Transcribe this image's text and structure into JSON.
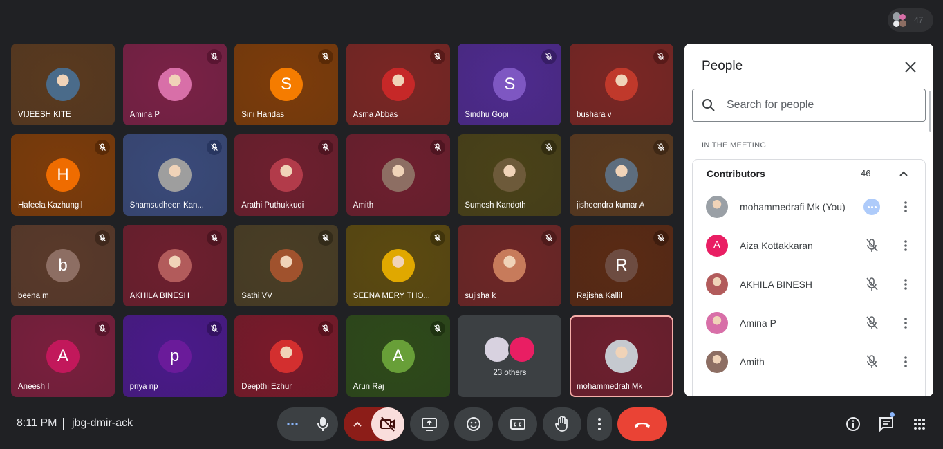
{
  "participant_count": "47",
  "tiles": [
    {
      "name": "VIJEESH KITE",
      "bg": "#5a3a1f",
      "avatar": {
        "kind": "photo",
        "color": "#4a6b8a"
      },
      "muted": false,
      "mute_bg": ""
    },
    {
      "name": "Amina P",
      "bg": "#7a2146",
      "avatar": {
        "kind": "photo",
        "color": "#d86fa8"
      },
      "muted": true,
      "mute_bg": "#5a1532"
    },
    {
      "name": "Sini Haridas",
      "bg": "#7d3c0a",
      "avatar": {
        "kind": "letter",
        "letter": "S",
        "color": "#f57c00"
      },
      "muted": true,
      "mute_bg": "#5a2a06"
    },
    {
      "name": "Asma Abbas",
      "bg": "#7a2624",
      "avatar": {
        "kind": "photo",
        "color": "#c62828"
      },
      "muted": true,
      "mute_bg": "#581a19"
    },
    {
      "name": "Sindhu Gopi",
      "bg": "#4e2a8e",
      "avatar": {
        "kind": "letter",
        "letter": "S",
        "color": "#7e57c2"
      },
      "muted": true,
      "mute_bg": "#371d66"
    },
    {
      "name": "bushara v",
      "bg": "#7a2624",
      "avatar": {
        "kind": "photo",
        "color": "#c0392b"
      },
      "muted": true,
      "mute_bg": "#581a19"
    },
    {
      "name": "Hafeela Kazhungil",
      "bg": "#7d3c0a",
      "avatar": {
        "kind": "letter",
        "letter": "H",
        "color": "#ef6c00"
      },
      "muted": true,
      "mute_bg": "#5a2a06"
    },
    {
      "name": "Shamsudheen Kan...",
      "bg": "#3a4a7a",
      "avatar": {
        "kind": "photo",
        "color": "#9e9e9e"
      },
      "muted": true,
      "mute_bg": "#283660"
    },
    {
      "name": "Arathi Puthukkudi",
      "bg": "#6e1f2e",
      "avatar": {
        "kind": "photo",
        "color": "#b23b4a"
      },
      "muted": true,
      "mute_bg": "#4f1521"
    },
    {
      "name": "Amith",
      "bg": "#6e1f2e",
      "avatar": {
        "kind": "photo",
        "color": "#8d6e63"
      },
      "muted": true,
      "mute_bg": "#4f1521"
    },
    {
      "name": "Sumesh Kandoth",
      "bg": "#4a4218",
      "avatar": {
        "kind": "photo",
        "color": "#6d5a3a"
      },
      "muted": true,
      "mute_bg": "#332d10"
    },
    {
      "name": "jisheendra kumar A",
      "bg": "#5a3a1f",
      "avatar": {
        "kind": "photo",
        "color": "#5d6d7e"
      },
      "muted": true,
      "mute_bg": "#3f2815"
    },
    {
      "name": "beena m",
      "bg": "#5a3a2a",
      "avatar": {
        "kind": "letter",
        "letter": "b",
        "color": "#8d6e63"
      },
      "muted": true,
      "mute_bg": "#3f281c"
    },
    {
      "name": "AKHILA BINESH",
      "bg": "#6e1f2e",
      "avatar": {
        "kind": "photo",
        "color": "#b25b5b"
      },
      "muted": true,
      "mute_bg": "#4f1521"
    },
    {
      "name": "Sathi VV",
      "bg": "#4a3e25",
      "avatar": {
        "kind": "photo",
        "color": "#a0522d"
      },
      "muted": true,
      "mute_bg": "#332b19"
    },
    {
      "name": "SEENA MERY THO...",
      "bg": "#5c4a10",
      "avatar": {
        "kind": "photo",
        "color": "#e0a800"
      },
      "muted": true,
      "mute_bg": "#40340b"
    },
    {
      "name": "sujisha k",
      "bg": "#6e2626",
      "avatar": {
        "kind": "photo",
        "color": "#c77b5b"
      },
      "muted": true,
      "mute_bg": "#4f1b1b"
    },
    {
      "name": "Rajisha Kallil",
      "bg": "#5a2a14",
      "avatar": {
        "kind": "letter",
        "letter": "R",
        "color": "#6d4c41"
      },
      "muted": true,
      "mute_bg": "#3f1d0e"
    },
    {
      "name": "Aneesh I",
      "bg": "#7a1f3d",
      "avatar": {
        "kind": "letter",
        "letter": "A",
        "color": "#c2185b"
      },
      "muted": true,
      "mute_bg": "#59162c"
    },
    {
      "name": "priya np",
      "bg": "#4a1a8a",
      "avatar": {
        "kind": "letter",
        "letter": "p",
        "color": "#6a1b9a"
      },
      "muted": true,
      "mute_bg": "#341262"
    },
    {
      "name": "Deepthi Ezhur",
      "bg": "#7a1a2a",
      "avatar": {
        "kind": "photo",
        "color": "#d32f2f"
      },
      "muted": true,
      "mute_bg": "#59121e"
    },
    {
      "name": "Arun Raj",
      "bg": "#2e4a1a",
      "avatar": {
        "kind": "letter",
        "letter": "A",
        "color": "#689f38"
      },
      "muted": true,
      "mute_bg": "#1f3311"
    },
    {
      "name": "others",
      "others_label": "23 others"
    },
    {
      "name": "mohammedrafi Mk",
      "bg": "#6e1f2e",
      "avatar": {
        "kind": "photo",
        "color": "#c5c9cf"
      },
      "muted": false,
      "self": true
    }
  ],
  "panel": {
    "title": "People",
    "search_placeholder": "Search for people",
    "section_label": "IN THE MEETING",
    "contributors_label": "Contributors",
    "contributors_count": "46",
    "rows": [
      {
        "name": "mohammedrafi Mk (You)",
        "avatar_kind": "photo",
        "avatar_color": "#9aa0a6",
        "state": "speaking"
      },
      {
        "name": "Aiza Kottakkaran",
        "avatar_kind": "letter",
        "letter": "A",
        "avatar_color": "#e91e63",
        "state": "muted"
      },
      {
        "name": "AKHILA BINESH",
        "avatar_kind": "photo",
        "avatar_color": "#b25b5b",
        "state": "muted"
      },
      {
        "name": "Amina P",
        "avatar_kind": "photo",
        "avatar_color": "#d86fa8",
        "state": "muted"
      },
      {
        "name": "Amith",
        "avatar_kind": "photo",
        "avatar_color": "#8d6e63",
        "state": "muted"
      }
    ]
  },
  "bottom": {
    "time": "8:11 PM",
    "meeting_code": "jbg-dmir-ack"
  },
  "colors": {
    "background": "#202124",
    "end_call": "#ea4335",
    "camera_off_bg": "#f9dedc",
    "camera_chevron_bg": "#8c1d18",
    "accent": "#8ab4f8"
  }
}
